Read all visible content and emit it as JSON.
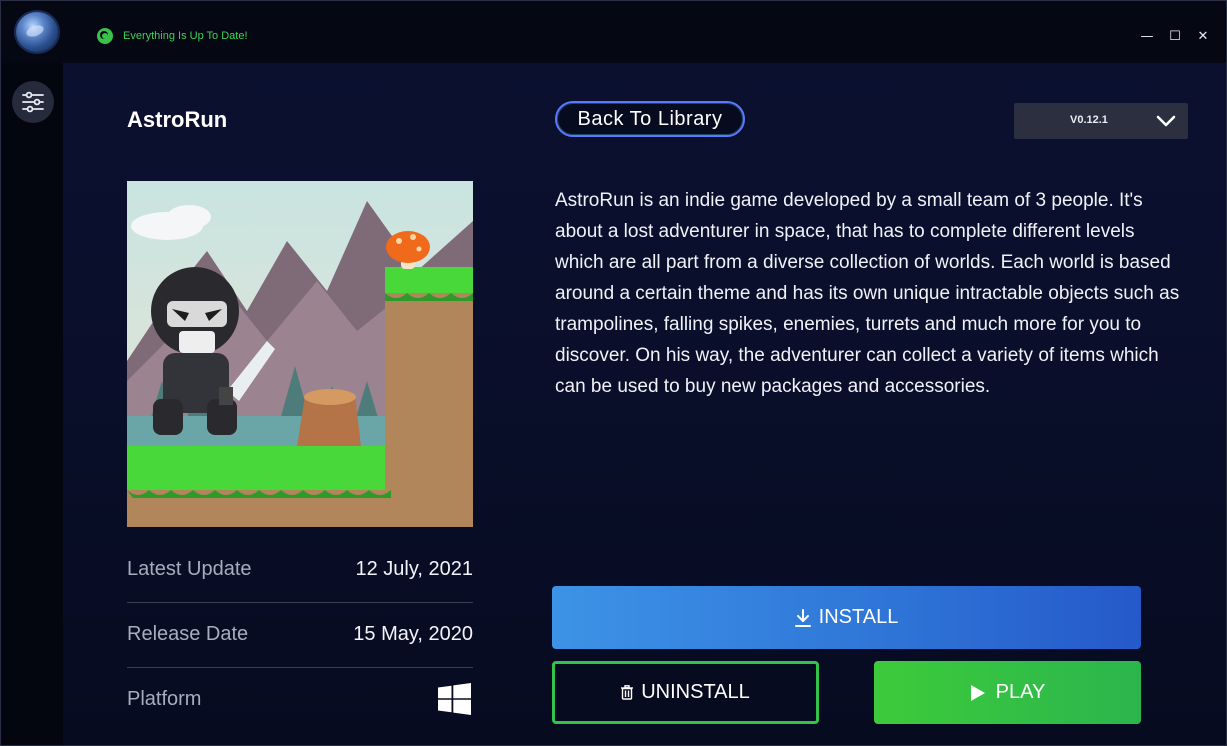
{
  "titlebar": {
    "status_text": "Everything Is Up To Date!",
    "minimize_glyph": "—",
    "maximize_glyph": "☐",
    "close_glyph": "✕",
    "icons": [
      "globe-icon",
      "minimize-icon",
      "maximize-icon",
      "close-icon"
    ]
  },
  "sidebar": {
    "icons": [
      "filter-sliders-icon"
    ]
  },
  "game": {
    "title": "AstroRun",
    "description": "AstroRun is an indie game developed by a small team of 3 people. It's about a lost adventurer in space, that has to complete different levels which are all part from a diverse collection of worlds. Each world is based around a certain theme and has its own unique intractable objects such as trampolines, falling spikes, enemies, turrets and much more for you to discover. On his way, the adventurer can collect a variety of items which can be used to buy new packages and accessories."
  },
  "nav": {
    "back_label": "Back To Library"
  },
  "version": {
    "selected": "V0.12.1"
  },
  "meta": {
    "latest_update_label": "Latest Update",
    "latest_update_value": "12 July, 2021",
    "release_date_label": "Release Date",
    "release_date_value": "15 May, 2020",
    "platform_label": "Platform",
    "platform_icon": "windows-icon"
  },
  "actions": {
    "install_label": "INSTALL",
    "uninstall_label": "UNINSTALL",
    "play_label": "PLAY"
  },
  "colors": {
    "accent_blue": "#3d93e6",
    "accent_green": "#33c24a",
    "status_green": "#3ed156",
    "background": "#0a0f2c"
  }
}
